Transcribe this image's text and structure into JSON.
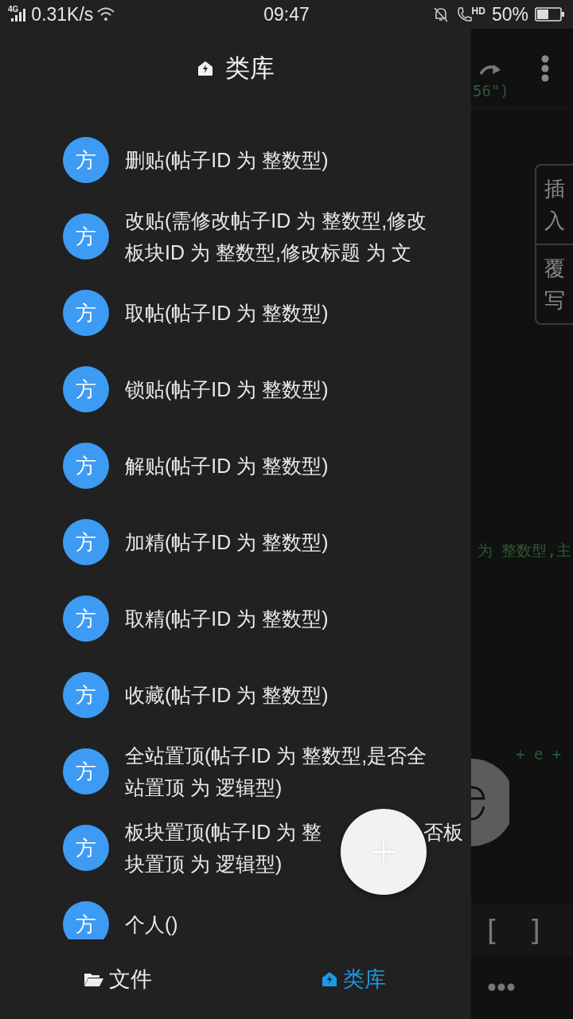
{
  "status_bar": {
    "network": "4G",
    "speed": "0.31K/s",
    "time": "09:47",
    "call_badge": "HD",
    "battery": "50%"
  },
  "drawer": {
    "title": "类库",
    "items": [
      {
        "badge": "方",
        "lines": [
          "删贴(帖子ID 为 整数型)"
        ]
      },
      {
        "badge": "方",
        "lines": [
          "改贴(需修改帖子ID 为 整数型,修改",
          "板块ID 为 整数型,修改标题 为 文"
        ]
      },
      {
        "badge": "方",
        "lines": [
          "取帖(帖子ID 为 整数型)"
        ]
      },
      {
        "badge": "方",
        "lines": [
          "锁贴(帖子ID 为 整数型)"
        ]
      },
      {
        "badge": "方",
        "lines": [
          "解贴(帖子ID 为 整数型)"
        ]
      },
      {
        "badge": "方",
        "lines": [
          "加精(帖子ID 为 整数型)"
        ]
      },
      {
        "badge": "方",
        "lines": [
          "取精(帖子ID 为 整数型)"
        ]
      },
      {
        "badge": "方",
        "lines": [
          "收藏(帖子ID 为 整数型)"
        ]
      },
      {
        "badge": "方",
        "lines": [
          "全站置顶(帖子ID 为 整数型,是否全",
          "站置顶 为 逻辑型)"
        ]
      },
      {
        "badge": "方",
        "lines": [
          [
            "板块置顶(帖子ID 为 整",
            "否板"
          ],
          "块置顶 为 逻辑型)"
        ]
      },
      {
        "badge": "方",
        "lines": [
          "个人()"
        ]
      }
    ],
    "bottom_nav": [
      {
        "label": "文件",
        "selected": false
      },
      {
        "label": "类库",
        "selected": true
      }
    ]
  },
  "editor": {
    "code": [
      "56\")",
      "为 整数型,主",
      "+ e +"
    ],
    "side_tabs": [
      "插入",
      "覆写"
    ],
    "toolbar": [
      "[",
      "]"
    ]
  }
}
